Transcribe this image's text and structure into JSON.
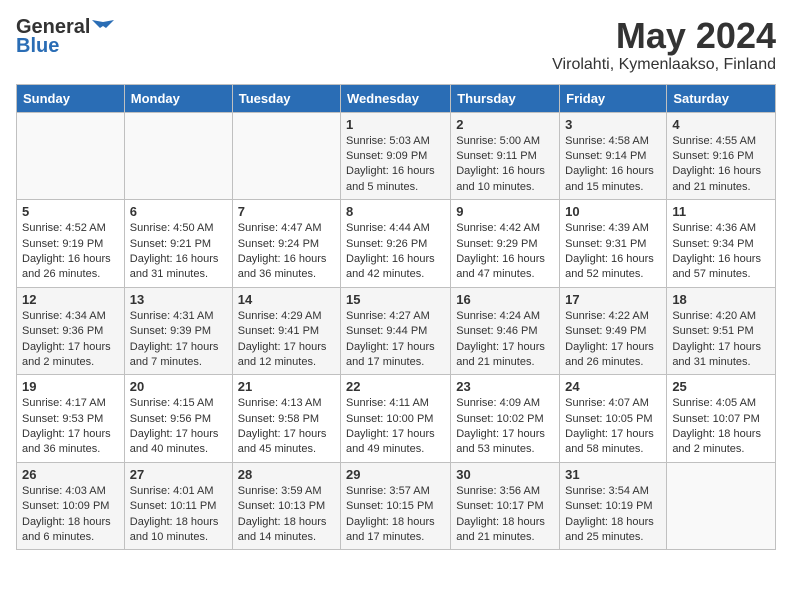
{
  "header": {
    "logo_general": "General",
    "logo_blue": "Blue",
    "month": "May 2024",
    "location": "Virolahti, Kymenlaakso, Finland"
  },
  "weekdays": [
    "Sunday",
    "Monday",
    "Tuesday",
    "Wednesday",
    "Thursday",
    "Friday",
    "Saturday"
  ],
  "weeks": [
    [
      {
        "day": "",
        "sunrise": "",
        "sunset": "",
        "daylight": ""
      },
      {
        "day": "",
        "sunrise": "",
        "sunset": "",
        "daylight": ""
      },
      {
        "day": "",
        "sunrise": "",
        "sunset": "",
        "daylight": ""
      },
      {
        "day": "1",
        "sunrise": "Sunrise: 5:03 AM",
        "sunset": "Sunset: 9:09 PM",
        "daylight": "Daylight: 16 hours and 5 minutes."
      },
      {
        "day": "2",
        "sunrise": "Sunrise: 5:00 AM",
        "sunset": "Sunset: 9:11 PM",
        "daylight": "Daylight: 16 hours and 10 minutes."
      },
      {
        "day": "3",
        "sunrise": "Sunrise: 4:58 AM",
        "sunset": "Sunset: 9:14 PM",
        "daylight": "Daylight: 16 hours and 15 minutes."
      },
      {
        "day": "4",
        "sunrise": "Sunrise: 4:55 AM",
        "sunset": "Sunset: 9:16 PM",
        "daylight": "Daylight: 16 hours and 21 minutes."
      }
    ],
    [
      {
        "day": "5",
        "sunrise": "Sunrise: 4:52 AM",
        "sunset": "Sunset: 9:19 PM",
        "daylight": "Daylight: 16 hours and 26 minutes."
      },
      {
        "day": "6",
        "sunrise": "Sunrise: 4:50 AM",
        "sunset": "Sunset: 9:21 PM",
        "daylight": "Daylight: 16 hours and 31 minutes."
      },
      {
        "day": "7",
        "sunrise": "Sunrise: 4:47 AM",
        "sunset": "Sunset: 9:24 PM",
        "daylight": "Daylight: 16 hours and 36 minutes."
      },
      {
        "day": "8",
        "sunrise": "Sunrise: 4:44 AM",
        "sunset": "Sunset: 9:26 PM",
        "daylight": "Daylight: 16 hours and 42 minutes."
      },
      {
        "day": "9",
        "sunrise": "Sunrise: 4:42 AM",
        "sunset": "Sunset: 9:29 PM",
        "daylight": "Daylight: 16 hours and 47 minutes."
      },
      {
        "day": "10",
        "sunrise": "Sunrise: 4:39 AM",
        "sunset": "Sunset: 9:31 PM",
        "daylight": "Daylight: 16 hours and 52 minutes."
      },
      {
        "day": "11",
        "sunrise": "Sunrise: 4:36 AM",
        "sunset": "Sunset: 9:34 PM",
        "daylight": "Daylight: 16 hours and 57 minutes."
      }
    ],
    [
      {
        "day": "12",
        "sunrise": "Sunrise: 4:34 AM",
        "sunset": "Sunset: 9:36 PM",
        "daylight": "Daylight: 17 hours and 2 minutes."
      },
      {
        "day": "13",
        "sunrise": "Sunrise: 4:31 AM",
        "sunset": "Sunset: 9:39 PM",
        "daylight": "Daylight: 17 hours and 7 minutes."
      },
      {
        "day": "14",
        "sunrise": "Sunrise: 4:29 AM",
        "sunset": "Sunset: 9:41 PM",
        "daylight": "Daylight: 17 hours and 12 minutes."
      },
      {
        "day": "15",
        "sunrise": "Sunrise: 4:27 AM",
        "sunset": "Sunset: 9:44 PM",
        "daylight": "Daylight: 17 hours and 17 minutes."
      },
      {
        "day": "16",
        "sunrise": "Sunrise: 4:24 AM",
        "sunset": "Sunset: 9:46 PM",
        "daylight": "Daylight: 17 hours and 21 minutes."
      },
      {
        "day": "17",
        "sunrise": "Sunrise: 4:22 AM",
        "sunset": "Sunset: 9:49 PM",
        "daylight": "Daylight: 17 hours and 26 minutes."
      },
      {
        "day": "18",
        "sunrise": "Sunrise: 4:20 AM",
        "sunset": "Sunset: 9:51 PM",
        "daylight": "Daylight: 17 hours and 31 minutes."
      }
    ],
    [
      {
        "day": "19",
        "sunrise": "Sunrise: 4:17 AM",
        "sunset": "Sunset: 9:53 PM",
        "daylight": "Daylight: 17 hours and 36 minutes."
      },
      {
        "day": "20",
        "sunrise": "Sunrise: 4:15 AM",
        "sunset": "Sunset: 9:56 PM",
        "daylight": "Daylight: 17 hours and 40 minutes."
      },
      {
        "day": "21",
        "sunrise": "Sunrise: 4:13 AM",
        "sunset": "Sunset: 9:58 PM",
        "daylight": "Daylight: 17 hours and 45 minutes."
      },
      {
        "day": "22",
        "sunrise": "Sunrise: 4:11 AM",
        "sunset": "Sunset: 10:00 PM",
        "daylight": "Daylight: 17 hours and 49 minutes."
      },
      {
        "day": "23",
        "sunrise": "Sunrise: 4:09 AM",
        "sunset": "Sunset: 10:02 PM",
        "daylight": "Daylight: 17 hours and 53 minutes."
      },
      {
        "day": "24",
        "sunrise": "Sunrise: 4:07 AM",
        "sunset": "Sunset: 10:05 PM",
        "daylight": "Daylight: 17 hours and 58 minutes."
      },
      {
        "day": "25",
        "sunrise": "Sunrise: 4:05 AM",
        "sunset": "Sunset: 10:07 PM",
        "daylight": "Daylight: 18 hours and 2 minutes."
      }
    ],
    [
      {
        "day": "26",
        "sunrise": "Sunrise: 4:03 AM",
        "sunset": "Sunset: 10:09 PM",
        "daylight": "Daylight: 18 hours and 6 minutes."
      },
      {
        "day": "27",
        "sunrise": "Sunrise: 4:01 AM",
        "sunset": "Sunset: 10:11 PM",
        "daylight": "Daylight: 18 hours and 10 minutes."
      },
      {
        "day": "28",
        "sunrise": "Sunrise: 3:59 AM",
        "sunset": "Sunset: 10:13 PM",
        "daylight": "Daylight: 18 hours and 14 minutes."
      },
      {
        "day": "29",
        "sunrise": "Sunrise: 3:57 AM",
        "sunset": "Sunset: 10:15 PM",
        "daylight": "Daylight: 18 hours and 17 minutes."
      },
      {
        "day": "30",
        "sunrise": "Sunrise: 3:56 AM",
        "sunset": "Sunset: 10:17 PM",
        "daylight": "Daylight: 18 hours and 21 minutes."
      },
      {
        "day": "31",
        "sunrise": "Sunrise: 3:54 AM",
        "sunset": "Sunset: 10:19 PM",
        "daylight": "Daylight: 18 hours and 25 minutes."
      },
      {
        "day": "",
        "sunrise": "",
        "sunset": "",
        "daylight": ""
      }
    ]
  ]
}
